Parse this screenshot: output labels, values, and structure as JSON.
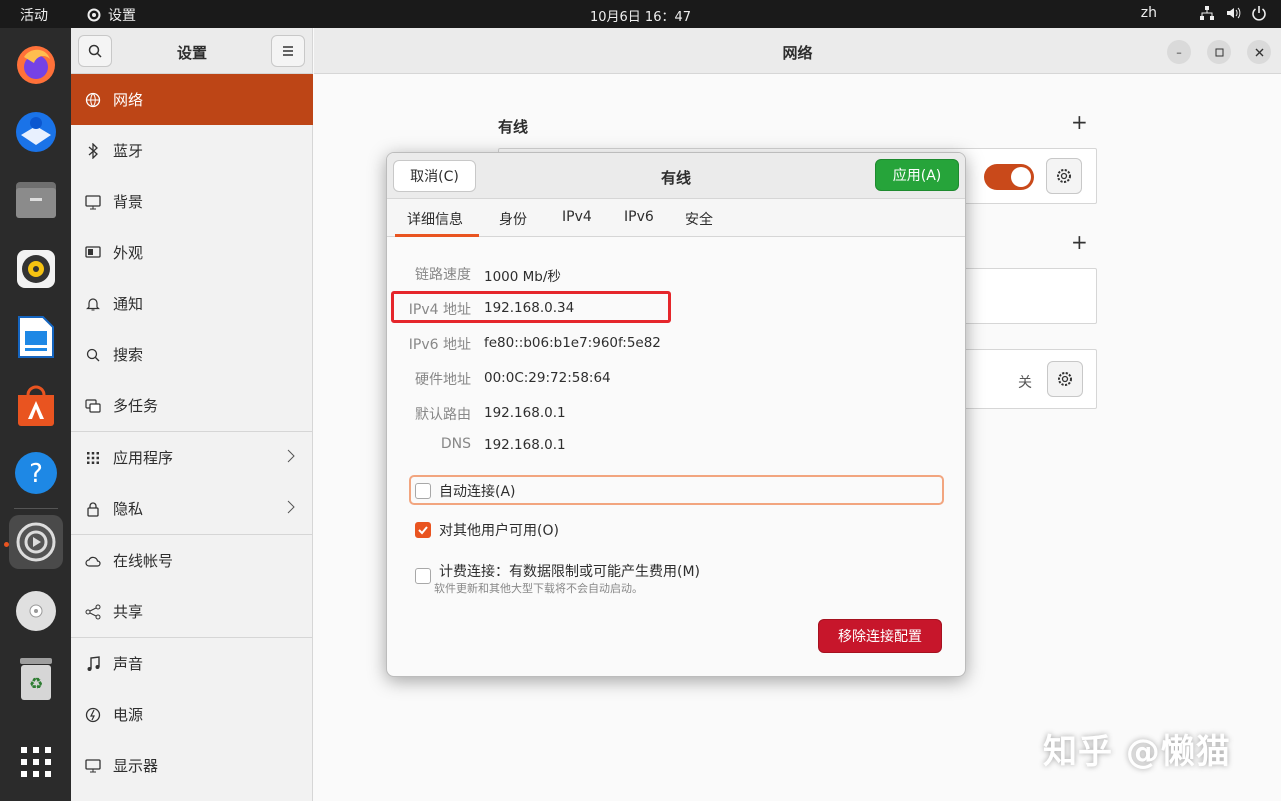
{
  "topbar": {
    "activities": "活动",
    "app_name": "设置",
    "clock": "10月6日  16：47",
    "lang": "zh"
  },
  "dock": {
    "items": [
      "firefox-icon",
      "thunderbird-icon",
      "files-icon",
      "rhythmbox-icon",
      "libreoffice-writer-icon",
      "app-center-icon",
      "help-icon",
      "settings-icon",
      "dvd-icon",
      "trash-icon",
      "show-apps-icon"
    ]
  },
  "sidebar": {
    "title": "设置",
    "items": [
      {
        "label": "网络",
        "icon": "network-icon"
      },
      {
        "label": "蓝牙",
        "icon": "bluetooth-icon"
      },
      {
        "label": "背景",
        "icon": "background-icon"
      },
      {
        "label": "外观",
        "icon": "appearance-icon"
      },
      {
        "label": "通知",
        "icon": "bell-icon"
      },
      {
        "label": "搜索",
        "icon": "search-icon"
      },
      {
        "label": "多任务",
        "icon": "multitasking-icon"
      },
      {
        "label": "应用程序",
        "icon": "apps-grid-icon"
      },
      {
        "label": "隐私",
        "icon": "lock-icon"
      },
      {
        "label": "在线帐号",
        "icon": "cloud-icon"
      },
      {
        "label": "共享",
        "icon": "share-icon"
      },
      {
        "label": "声音",
        "icon": "music-note-icon"
      },
      {
        "label": "电源",
        "icon": "power-icon"
      },
      {
        "label": "显示器",
        "icon": "display-icon"
      }
    ]
  },
  "main": {
    "title": "网络",
    "wired_section": "有线",
    "off_label": "关"
  },
  "dialog": {
    "cancel": "取消(C)",
    "title": "有线",
    "apply": "应用(A)",
    "tabs": [
      "详细信息",
      "身份",
      "IPv4",
      "IPv6",
      "安全"
    ],
    "details": [
      {
        "label": "链路速度",
        "value": "1000 Mb/秒"
      },
      {
        "label": "IPv4 地址",
        "value": "192.168.0.34"
      },
      {
        "label": "IPv6 地址",
        "value": "fe80::b06:b1e7:960f:5e82"
      },
      {
        "label": "硬件地址",
        "value": "00:0C:29:72:58:64"
      },
      {
        "label": "默认路由",
        "value": "192.168.0.1"
      },
      {
        "label": "DNS",
        "value": "192.168.0.1"
      }
    ],
    "auto_connect": "自动连接(A)",
    "all_users": "对其他用户可用(O)",
    "metered": "计费连接：有数据限制或可能产生费用(M)",
    "metered_note": "软件更新和其他大型下载将不会自动启动。",
    "remove": "移除连接配置"
  },
  "watermark": "知乎 @懒猫",
  "colors": {
    "accent": "#e95420",
    "selected_sidebar": "#bd4516",
    "apply": "#26a43a",
    "remove": "#c7162b",
    "highlight_box": "#e5262b"
  }
}
